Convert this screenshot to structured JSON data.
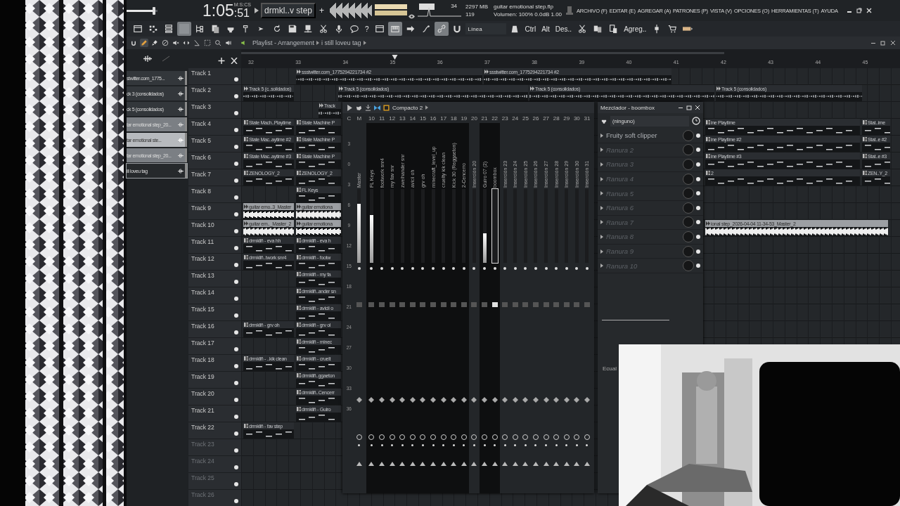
{
  "top_bar": {
    "master_volume": {
      "level": 0.88
    },
    "time_main": "1:05",
    "time_small": ":51",
    "time_format": "M:S:CS",
    "pattern": "drmkl..v step",
    "add": "+",
    "cpu": "34",
    "memory": "2297 MB",
    "polyphony": "119",
    "project": "guitar emotional step.flp",
    "volume": "Volumen: 100%  0.0dB  1.00"
  },
  "menu": [
    "ARCHIVO (F)",
    "EDITAR (E)",
    "AGREGAR (A)",
    "PATRONES (P)",
    "VISTA (V)",
    "OPCIONES (O)",
    "HERRAMIENTAS (T)",
    "AYUDA"
  ],
  "toolbar": [
    {
      "kind": "icon",
      "on": false
    },
    {
      "kind": "icon",
      "on": false
    },
    {
      "kind": "icon",
      "on": false
    },
    {
      "kind": "icon",
      "on": true
    },
    {
      "kind": "icon",
      "on": false
    },
    {
      "kind": "icon",
      "on": false
    },
    {
      "kind": "icon",
      "on": false
    },
    {
      "kind": "icon",
      "on": false
    },
    {
      "kind": "icon",
      "on": false
    },
    {
      "kind": "icon",
      "on": false
    },
    {
      "kind": "icon",
      "on": false
    },
    {
      "kind": "icon",
      "on": false
    },
    {
      "kind": "icon",
      "on": false
    },
    {
      "kind": "icon",
      "on": false
    },
    {
      "kind": "icon",
      "on": false
    },
    {
      "kind": "text",
      "label": "?"
    },
    {
      "kind": "icon",
      "on": false
    },
    {
      "kind": "icon",
      "on": true
    },
    {
      "kind": "icon",
      "on": false
    },
    {
      "kind": "icon",
      "on": false
    },
    {
      "kind": "icon",
      "on": true
    },
    {
      "kind": "icon",
      "on": false
    },
    {
      "kind": "dropdown",
      "label": "Línea"
    },
    {
      "kind": "icon",
      "on": false
    },
    {
      "kind": "text",
      "label": "Ctrl"
    },
    {
      "kind": "text",
      "label": "Alt"
    },
    {
      "kind": "text",
      "label": "Des.."
    },
    {
      "kind": "icon",
      "on": false
    },
    {
      "kind": "icon",
      "on": false
    },
    {
      "kind": "icon",
      "on": false
    },
    {
      "kind": "text",
      "label": "Agreg.."
    },
    {
      "kind": "icon",
      "on": false
    },
    {
      "kind": "icon",
      "on": false
    },
    {
      "kind": "icon",
      "on": false
    }
  ],
  "tools": [
    {
      "selected": true
    },
    {
      "selected": false
    },
    {
      "selected": false
    },
    {
      "selected": false
    },
    {
      "selected": false
    },
    {
      "selected": false
    },
    {
      "selected": false
    },
    {
      "selected": false
    },
    {
      "selected": false
    }
  ],
  "playlist": {
    "title": "Playlist - Arrangement",
    "pattern": "i still loveu tag",
    "picker": [
      {
        "label": "stwitter.com_1775...",
        "kind": "pattern",
        "highlighted": false,
        "selected": false
      },
      {
        "label": "ck 3 (consolidados)",
        "kind": "pattern",
        "highlighted": false,
        "selected": false
      },
      {
        "label": "ck 5 (consolidados)",
        "kind": "pattern",
        "highlighted": false,
        "selected": false
      },
      {
        "label": "tar emotional step_20...",
        "kind": "audio",
        "highlighted": false,
        "selected": false
      },
      {
        "label": "tar emotional ste...",
        "kind": "audio",
        "highlighted": true,
        "selected": false
      },
      {
        "label": "tar emotional step_20...",
        "kind": "audio",
        "highlighted": false,
        "selected": false
      },
      {
        "label": "ill loveu tag",
        "kind": "pattern",
        "highlighted": false,
        "selected": true
      }
    ],
    "ruler": [
      "32",
      "33",
      "34",
      "35",
      "36",
      "37",
      "38",
      "39",
      "40",
      "41",
      "42",
      "43",
      "44",
      "45"
    ],
    "tracks": [
      {
        "name": "Track 1",
        "dimmed": false,
        "clips": [
          {
            "label": "ssstwitter.com_1775294221734 #2",
            "kind": "audio"
          },
          {
            "label": "ssstwitter.com_1775294221734 #2",
            "kind": "audio"
          }
        ]
      },
      {
        "name": "Track 2",
        "dimmed": false,
        "clips": [
          {
            "label": "Track 5 (c..solidados)",
            "kind": "audio"
          },
          {
            "label": "Track 5 (consolidados)",
            "kind": "audio"
          },
          {
            "label": "Track 5 (consolidados)",
            "kind": "audio"
          },
          {
            "label": "Track 5 (consolidados)",
            "kind": "audio"
          }
        ]
      },
      {
        "name": "Track 3",
        "dimmed": false,
        "clips": [
          {
            "label": "Track",
            "kind": "audio"
          }
        ]
      },
      {
        "name": "Track 4",
        "dimmed": false,
        "clips": [
          {
            "label": "State Mach..Playtime",
            "kind": "pattern"
          },
          {
            "label": "State Machine P",
            "kind": "pattern"
          },
          {
            "label": "ine Playtime",
            "kind": "pattern"
          },
          {
            "label": "Stat..ime",
            "kind": "pattern"
          }
        ]
      },
      {
        "name": "Track 5",
        "dimmed": false,
        "clips": [
          {
            "label": "State Mac..aytime #2",
            "kind": "pattern"
          },
          {
            "label": "State Machine P",
            "kind": "pattern"
          },
          {
            "label": "ine Playtime #2",
            "kind": "pattern"
          },
          {
            "label": "Stat..e #2",
            "kind": "pattern"
          }
        ]
      },
      {
        "name": "Track 6",
        "dimmed": false,
        "clips": [
          {
            "label": "State Mac..aytime #3",
            "kind": "pattern"
          },
          {
            "label": "State Machine P",
            "kind": "pattern"
          },
          {
            "label": "ine Playtime #3",
            "kind": "pattern"
          },
          {
            "label": "Stat..e #3",
            "kind": "pattern"
          }
        ]
      },
      {
        "name": "Track 7",
        "dimmed": false,
        "clips": [
          {
            "label": "ZENOLOGY_2",
            "kind": "pattern"
          },
          {
            "label": "ZENOLOGY_2",
            "kind": "pattern"
          },
          {
            "label": "2",
            "kind": "pattern"
          },
          {
            "label": "ZEN..Y_2",
            "kind": "pattern"
          }
        ]
      },
      {
        "name": "Track 8",
        "dimmed": false,
        "clips": [
          {
            "label": "FL Keys",
            "kind": "pattern"
          }
        ]
      },
      {
        "name": "Track 9",
        "dimmed": false,
        "clips": [
          {
            "label": "guitar emo..3_Master",
            "kind": "render"
          },
          {
            "label": "guitar emotiona",
            "kind": "render"
          }
        ]
      },
      {
        "name": "Track 10",
        "dimmed": false,
        "clips": [
          {
            "label": "guitar em.._Master_2",
            "kind": "render"
          },
          {
            "label": "guitar emotiona",
            "kind": "render"
          },
          {
            "label": "ional step_2026-04-04 11-34-53_Master_2",
            "kind": "render"
          }
        ]
      },
      {
        "name": "Track 11",
        "dimmed": false,
        "clips": [
          {
            "label": "drmkllñ - eva hh",
            "kind": "pattern"
          },
          {
            "label": "drmkllñ - eva h",
            "kind": "pattern"
          }
        ]
      },
      {
        "name": "Track 12",
        "dimmed": false,
        "clips": [
          {
            "label": "drmkllñ..twork snr4",
            "kind": "pattern"
          },
          {
            "label": "drmkllñ - footw",
            "kind": "pattern"
          }
        ]
      },
      {
        "name": "Track 13",
        "dimmed": false,
        "clips": [
          {
            "label": "drmkllñ - my fa",
            "kind": "pattern"
          }
        ]
      },
      {
        "name": "Track 14",
        "dimmed": false,
        "clips": [
          {
            "label": "drmkllñ..ander sn",
            "kind": "pattern"
          }
        ]
      },
      {
        "name": "Track 15",
        "dimmed": false,
        "clips": [
          {
            "label": "drmkllñ - avicii o",
            "kind": "pattern"
          }
        ]
      },
      {
        "name": "Track 16",
        "dimmed": false,
        "clips": [
          {
            "label": "drmkllñ - grv oh",
            "kind": "pattern"
          },
          {
            "label": "drmkllñ - grv ol",
            "kind": "pattern"
          }
        ]
      },
      {
        "name": "Track 17",
        "dimmed": false,
        "clips": [
          {
            "label": "drmkllñ - minec",
            "kind": "pattern"
          }
        ]
      },
      {
        "name": "Track 18",
        "dimmed": false,
        "clips": [
          {
            "label": "drmkllñ - ..kik clean",
            "kind": "pattern"
          },
          {
            "label": "drmkllñ - cruelt",
            "kind": "pattern"
          }
        ]
      },
      {
        "name": "Track 19",
        "dimmed": false,
        "clips": [
          {
            "label": "drmkllñ..ggaeton",
            "kind": "pattern"
          }
        ]
      },
      {
        "name": "Track 20",
        "dimmed": false,
        "clips": [
          {
            "label": "drmkllñ..Cencerr",
            "kind": "pattern"
          }
        ]
      },
      {
        "name": "Track 21",
        "dimmed": false,
        "clips": [
          {
            "label": "drmkllñ - Guiro",
            "kind": "pattern"
          }
        ]
      },
      {
        "name": "Track 22",
        "dimmed": false,
        "clips": [
          {
            "label": "drmkllñ - fav step",
            "kind": "pattern"
          }
        ]
      },
      {
        "name": "Track 23",
        "dimmed": true
      },
      {
        "name": "Track 24",
        "dimmed": true
      },
      {
        "name": "Track 25",
        "dimmed": true
      },
      {
        "name": "Track 26",
        "dimmed": true
      }
    ]
  },
  "mixer": {
    "title": "Compacto 2",
    "headers": [
      "C",
      "M",
      "10",
      "11",
      "12",
      "13",
      "14",
      "15",
      "16",
      "17",
      "18",
      "19",
      "20",
      "21",
      "22",
      "23",
      "24",
      "25",
      "26",
      "27",
      "28",
      "29",
      "30",
      "31"
    ],
    "scale": [
      "3",
      "0",
      "3",
      "6",
      "9",
      "12",
      "15",
      "18",
      "21",
      "24",
      "27",
      "30",
      "33",
      "36"
    ],
    "strips": [
      {
        "name": "Master",
        "level": 0.8,
        "used": false,
        "selected": false
      },
      {
        "name": "FL Keys",
        "level": 0.65,
        "used": true,
        "selected": false
      },
      {
        "name": "footwork snr4",
        "level": 0,
        "used": true,
        "selected": false
      },
      {
        "name": "my fav snr",
        "level": 0,
        "used": true,
        "selected": false
      },
      {
        "name": "zweihander snr",
        "level": 0,
        "used": true,
        "selected": false
      },
      {
        "name": "avicii oh",
        "level": 0,
        "used": true,
        "selected": false
      },
      {
        "name": "grv oh",
        "level": 0,
        "used": true,
        "selected": false
      },
      {
        "name": "minecraft_level_up",
        "level": 0,
        "used": true,
        "selected": false
      },
      {
        "name": "cruelty kik clean",
        "level": 0,
        "used": true,
        "selected": false
      },
      {
        "name": "Kick 30 (Reggaeton)",
        "level": 0,
        "used": true,
        "selected": false
      },
      {
        "name": "2-Cencerro",
        "level": 0,
        "used": true,
        "selected": false
      },
      {
        "name": "Inserción 20",
        "level": 0,
        "used": false,
        "selected": false
      },
      {
        "name": "Guiro 07 (2)",
        "level": 0.4,
        "used": true,
        "selected": false
      },
      {
        "name": "boombox",
        "level": 0,
        "used": true,
        "selected": true
      },
      {
        "name": "Inserción 23",
        "level": 0,
        "used": false,
        "selected": false
      },
      {
        "name": "Inserción 24",
        "level": 0,
        "used": false,
        "selected": false
      },
      {
        "name": "Inserción 25",
        "level": 0,
        "used": false,
        "selected": false
      },
      {
        "name": "Inserción 26",
        "level": 0,
        "used": false,
        "selected": false
      },
      {
        "name": "Inserción 27",
        "level": 0,
        "used": false,
        "selected": false
      },
      {
        "name": "Inserción 28",
        "level": 0,
        "used": false,
        "selected": false
      },
      {
        "name": "Inserción 29",
        "level": 0,
        "used": false,
        "selected": false
      },
      {
        "name": "Inserción 30",
        "level": 0,
        "used": false,
        "selected": false
      },
      {
        "name": "Inserción 31",
        "level": 0,
        "used": false,
        "selected": false
      }
    ]
  },
  "channel_panel": {
    "title": "Mezclador - boombox",
    "input": "(ninguno)",
    "slots": [
      {
        "label": "Fruity soft clipper",
        "active": true
      },
      {
        "label": "Ranura 2",
        "active": false
      },
      {
        "label": "Ranura 3",
        "active": false
      },
      {
        "label": "Ranura 4",
        "active": false
      },
      {
        "label": "Ranura 5",
        "active": false
      },
      {
        "label": "Ranura 6",
        "active": false
      },
      {
        "label": "Ranura 7",
        "active": false
      },
      {
        "label": "Ranura 8",
        "active": false
      },
      {
        "label": "Ranura 9",
        "active": false
      },
      {
        "label": "Ranura 10",
        "active": false
      }
    ],
    "eq_label": "Ecual"
  },
  "video": {
    "kind": "picture"
  }
}
